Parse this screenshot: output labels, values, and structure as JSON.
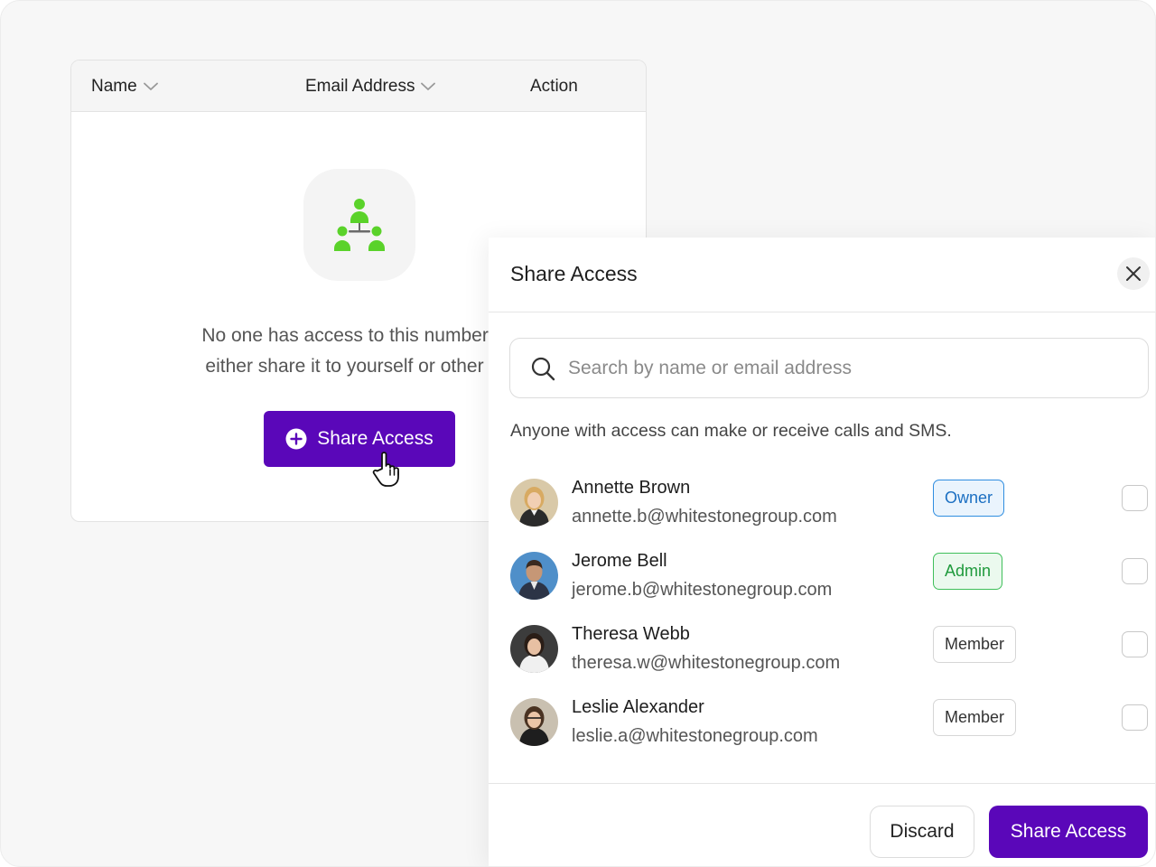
{
  "table": {
    "columns": {
      "name": "Name",
      "email": "Email Address",
      "action": "Action"
    },
    "empty_state": {
      "icon": "team-hierarchy-icon",
      "line1": "No one has access to this number yet",
      "line2": "either share it to yourself or other me",
      "button_label": "Share Access"
    }
  },
  "panel": {
    "title": "Share Access",
    "search_placeholder": "Search by name or email address",
    "info": "Anyone with access can make or receive calls and SMS.",
    "users": [
      {
        "name": "Annette Brown",
        "email": "annette.b@whitestonegroup.com",
        "role": "Owner"
      },
      {
        "name": "Jerome Bell",
        "email": "jerome.b@whitestonegroup.com",
        "role": "Admin"
      },
      {
        "name": "Theresa Webb",
        "email": "theresa.w@whitestonegroup.com",
        "role": "Member"
      },
      {
        "name": "Leslie Alexander",
        "email": "leslie.a@whitestonegroup.com",
        "role": "Member"
      }
    ],
    "footer": {
      "discard_label": "Discard",
      "share_label": "Share Access"
    }
  },
  "colors": {
    "primary": "#5a07b9",
    "owner": "#2f8de0",
    "admin": "#3fbf5a",
    "icon_green": "#5ad22a"
  }
}
